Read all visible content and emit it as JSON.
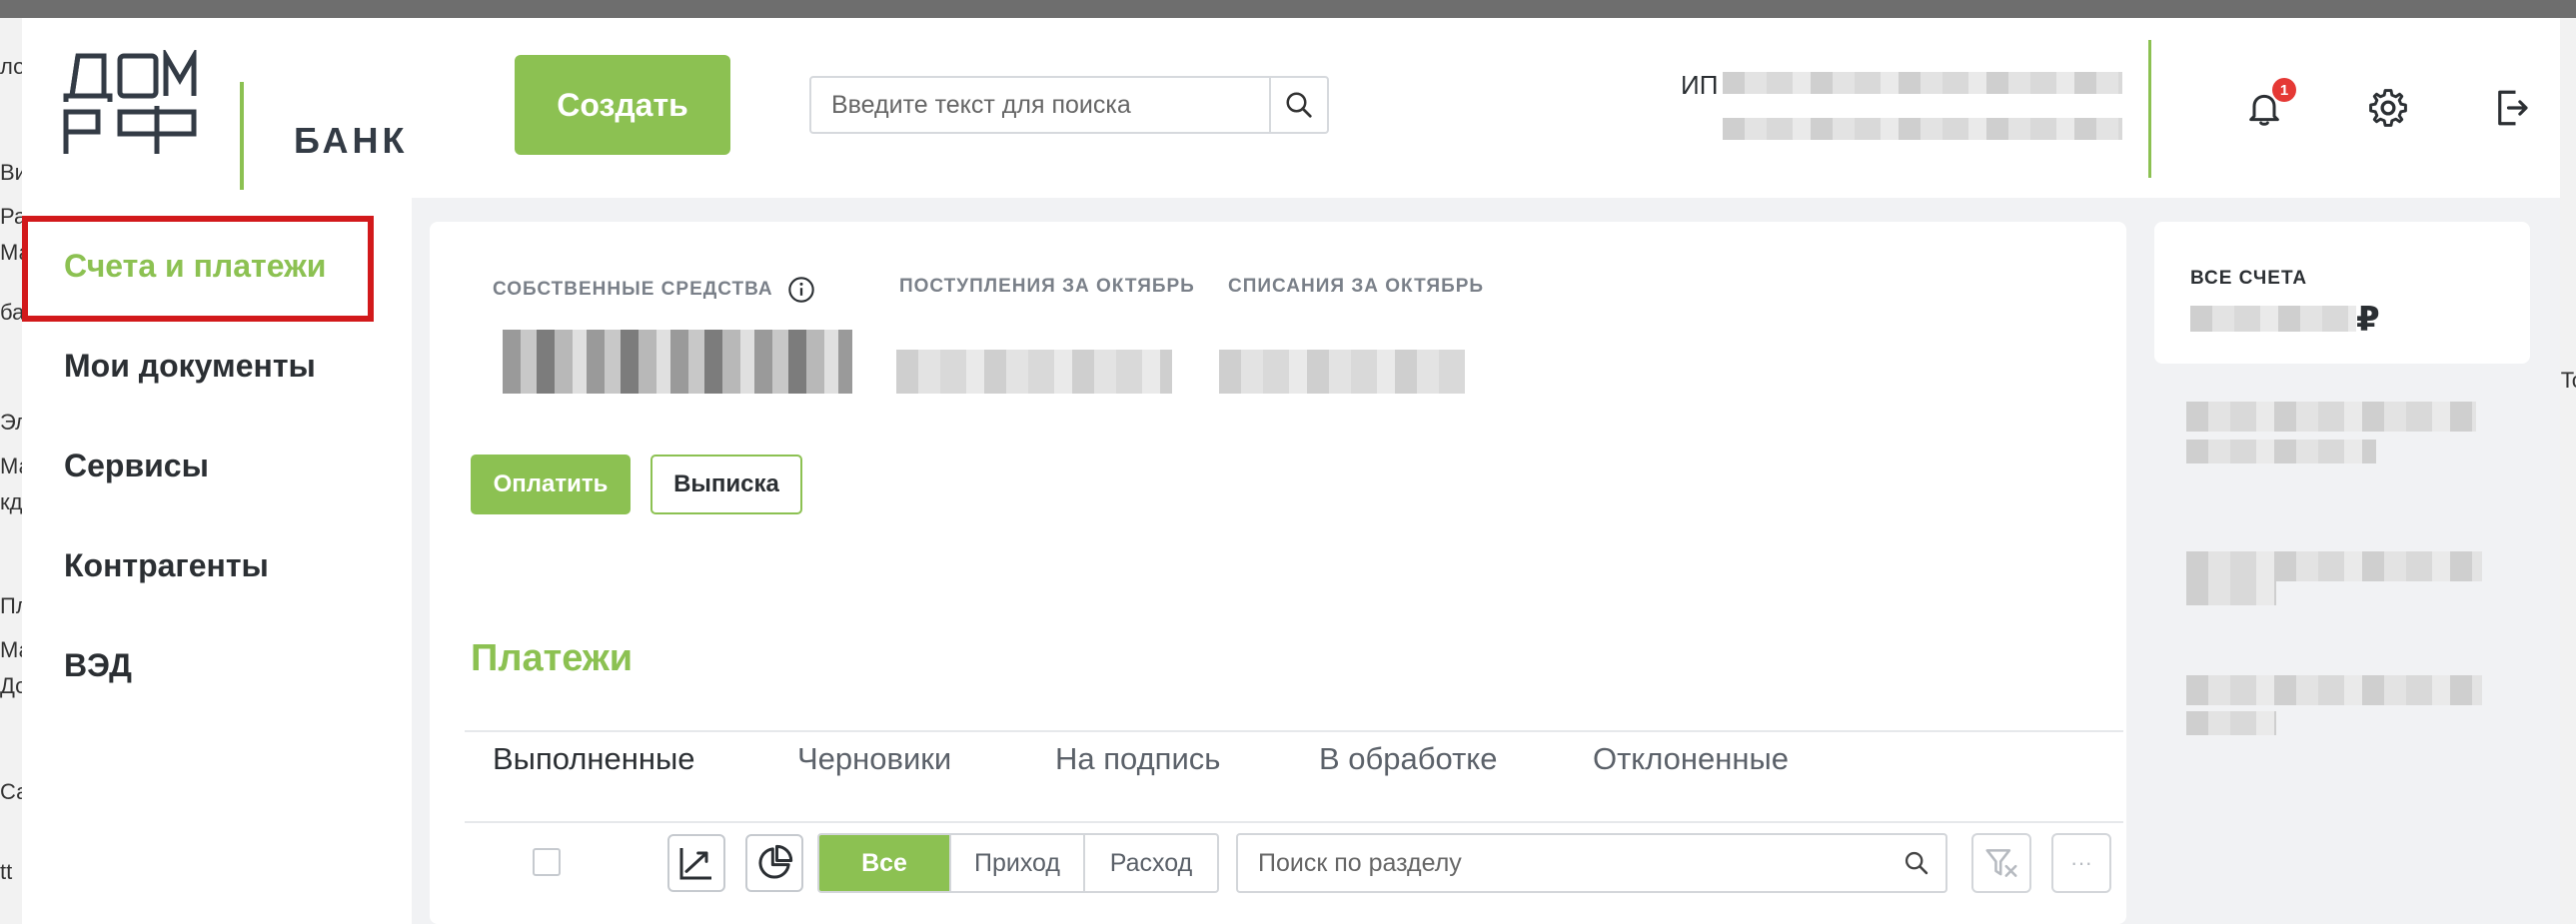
{
  "background_app": {
    "left_fragments": [
      "ло",
      "Виз",
      "Раз",
      "Ма",
      "ба",
      "Эли",
      "Ма",
      "кд",
      "Пле",
      "Ма",
      "До",
      "Сае",
      "tt"
    ],
    "right_fragments": [
      "i",
      "To"
    ]
  },
  "logo": {
    "brand": "ДОМ РФ",
    "bank_text": "БАНК",
    "accent_color": "#8cc152"
  },
  "sidebar": {
    "items": [
      {
        "label": "Счета и платежи",
        "active": true
      },
      {
        "label": "Мои документы",
        "active": false
      },
      {
        "label": "Сервисы",
        "active": false
      },
      {
        "label": "Контрагенты",
        "active": false
      },
      {
        "label": "ВЭД",
        "active": false
      }
    ],
    "highlight_color": "#d2191b"
  },
  "header": {
    "create_label": "Создать",
    "search_placeholder": "Введите текст для поиска",
    "user_prefix": "ИП",
    "notifications_count": "1",
    "icons": [
      "bell-icon",
      "gear-icon",
      "logout-icon"
    ]
  },
  "summary": {
    "own_funds_label": "СОБСТВЕННЫЕ СРЕДСТВА",
    "income_label": "ПОСТУПЛЕНИЯ ЗА ОКТЯБРЬ",
    "expense_label": "СПИСАНИЯ ЗА ОКТЯБРЬ",
    "pay_label": "Оплатить",
    "statement_label": "Выписка"
  },
  "payments": {
    "title": "Платежи",
    "tabs": [
      "Выполненные",
      "Черновики",
      "На подпись",
      "В обработке",
      "Отклоненные"
    ],
    "active_tab": 0,
    "filters": [
      "Все",
      "Приход",
      "Расход"
    ],
    "active_filter": 0,
    "section_search_placeholder": "Поиск по разделу",
    "more_label": "···"
  },
  "accounts": {
    "label": "ВСЕ СЧЕТА",
    "currency": "₽"
  }
}
